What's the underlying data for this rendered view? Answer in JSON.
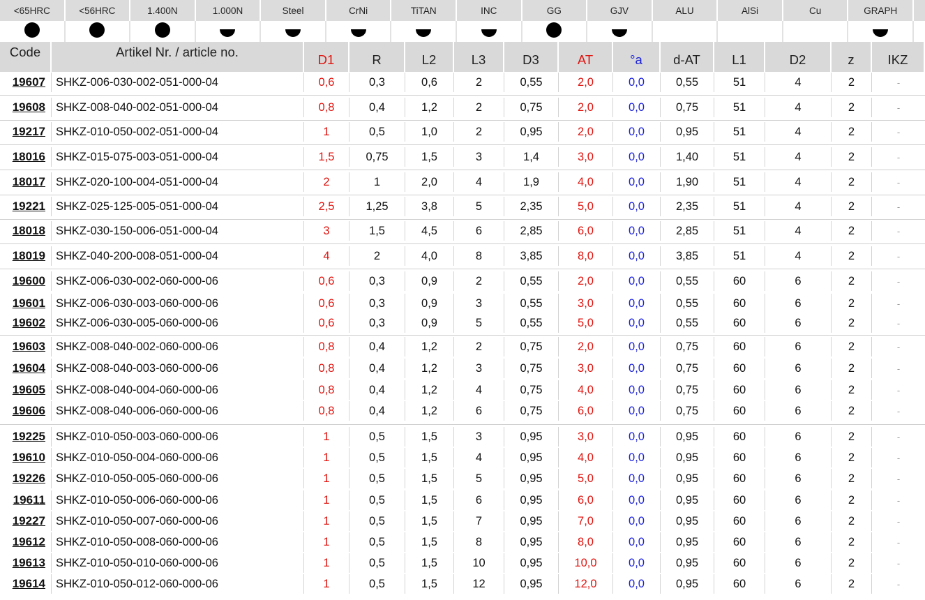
{
  "materials": {
    "labels": [
      "<65HRC",
      "<56HRC",
      "1.400N",
      "1.000N",
      "Steel",
      "CrNi",
      "TiTAN",
      "INC",
      "GG",
      "GJV",
      "ALU",
      "AlSi",
      "Cu",
      "GRAPH"
    ],
    "suitability": [
      "full",
      "full",
      "full",
      "half",
      "half",
      "half",
      "half",
      "half",
      "full",
      "half",
      "none",
      "none",
      "none",
      "half"
    ]
  },
  "columns": {
    "code": "Code",
    "article": "Artikel Nr. / article no.",
    "d1": "D1",
    "r": "R",
    "l2": "L2",
    "l3": "L3",
    "d3": "D3",
    "at": "AT",
    "angle": "°a",
    "dat": "d-AT",
    "l1": "L1",
    "d2": "D2",
    "z": "z",
    "ikz": "IKZ"
  },
  "rows": [
    {
      "code": "19607",
      "article": "SHKZ-006-030-002-051-000-04",
      "d1": "0,6",
      "r": "0,3",
      "l2": "0,6",
      "l3": "2",
      "d3": "0,55",
      "at": "2,0",
      "angle": "0,0",
      "dat": "0,55",
      "l1": "51",
      "d2": "4",
      "z": "2",
      "ikz": "-"
    },
    {
      "code": "19608",
      "article": "SHKZ-008-040-002-051-000-04",
      "d1": "0,8",
      "r": "0,4",
      "l2": "1,2",
      "l3": "2",
      "d3": "0,75",
      "at": "2,0",
      "angle": "0,0",
      "dat": "0,75",
      "l1": "51",
      "d2": "4",
      "z": "2",
      "ikz": "-"
    },
    {
      "code": "19217",
      "article": "SHKZ-010-050-002-051-000-04",
      "d1": "1",
      "r": "0,5",
      "l2": "1,0",
      "l3": "2",
      "d3": "0,95",
      "at": "2,0",
      "angle": "0,0",
      "dat": "0,95",
      "l1": "51",
      "d2": "4",
      "z": "2",
      "ikz": "-"
    },
    {
      "code": "18016",
      "article": "SHKZ-015-075-003-051-000-04",
      "d1": "1,5",
      "r": "0,75",
      "l2": "1,5",
      "l3": "3",
      "d3": "1,4",
      "at": "3,0",
      "angle": "0,0",
      "dat": "1,40",
      "l1": "51",
      "d2": "4",
      "z": "2",
      "ikz": "-"
    },
    {
      "code": "18017",
      "article": "SHKZ-020-100-004-051-000-04",
      "d1": "2",
      "r": "1",
      "l2": "2,0",
      "l3": "4",
      "d3": "1,9",
      "at": "4,0",
      "angle": "0,0",
      "dat": "1,90",
      "l1": "51",
      "d2": "4",
      "z": "2",
      "ikz": "-"
    },
    {
      "code": "19221",
      "article": "SHKZ-025-125-005-051-000-04",
      "d1": "2,5",
      "r": "1,25",
      "l2": "3,8",
      "l3": "5",
      "d3": "2,35",
      "at": "5,0",
      "angle": "0,0",
      "dat": "2,35",
      "l1": "51",
      "d2": "4",
      "z": "2",
      "ikz": "-"
    },
    {
      "code": "18018",
      "article": "SHKZ-030-150-006-051-000-04",
      "d1": "3",
      "r": "1,5",
      "l2": "4,5",
      "l3": "6",
      "d3": "2,85",
      "at": "6,0",
      "angle": "0,0",
      "dat": "2,85",
      "l1": "51",
      "d2": "4",
      "z": "2",
      "ikz": "-"
    },
    {
      "code": "18019",
      "article": "SHKZ-040-200-008-051-000-04",
      "d1": "4",
      "r": "2",
      "l2": "4,0",
      "l3": "8",
      "d3": "3,85",
      "at": "8,0",
      "angle": "0,0",
      "dat": "3,85",
      "l1": "51",
      "d2": "4",
      "z": "2",
      "ikz": "-"
    },
    {
      "code": "19600",
      "article": "SHKZ-006-030-002-060-000-06",
      "d1": "0,6",
      "r": "0,3",
      "l2": "0,9",
      "l3": "2",
      "d3": "0,55",
      "at": "2,0",
      "angle": "0,0",
      "dat": "0,55",
      "l1": "60",
      "d2": "6",
      "z": "2",
      "ikz": "-"
    },
    {
      "code": "19601",
      "article": "SHKZ-006-030-003-060-000-06",
      "d1": "0,6",
      "r": "0,3",
      "l2": "0,9",
      "l3": "3",
      "d3": "0,55",
      "at": "3,0",
      "angle": "0,0",
      "dat": "0,55",
      "l1": "60",
      "d2": "6",
      "z": "2",
      "ikz": "-"
    },
    {
      "code": "19602",
      "article": "SHKZ-006-030-005-060-000-06",
      "d1": "0,6",
      "r": "0,3",
      "l2": "0,9",
      "l3": "5",
      "d3": "0,55",
      "at": "5,0",
      "angle": "0,0",
      "dat": "0,55",
      "l1": "60",
      "d2": "6",
      "z": "2",
      "ikz": "-"
    },
    {
      "code": "19603",
      "article": "SHKZ-008-040-002-060-000-06",
      "d1": "0,8",
      "r": "0,4",
      "l2": "1,2",
      "l3": "2",
      "d3": "0,75",
      "at": "2,0",
      "angle": "0,0",
      "dat": "0,75",
      "l1": "60",
      "d2": "6",
      "z": "2",
      "ikz": "-"
    },
    {
      "code": "19604",
      "article": "SHKZ-008-040-003-060-000-06",
      "d1": "0,8",
      "r": "0,4",
      "l2": "1,2",
      "l3": "3",
      "d3": "0,75",
      "at": "3,0",
      "angle": "0,0",
      "dat": "0,75",
      "l1": "60",
      "d2": "6",
      "z": "2",
      "ikz": "-"
    },
    {
      "code": "19605",
      "article": "SHKZ-008-040-004-060-000-06",
      "d1": "0,8",
      "r": "0,4",
      "l2": "1,2",
      "l3": "4",
      "d3": "0,75",
      "at": "4,0",
      "angle": "0,0",
      "dat": "0,75",
      "l1": "60",
      "d2": "6",
      "z": "2",
      "ikz": "-"
    },
    {
      "code": "19606",
      "article": "SHKZ-008-040-006-060-000-06",
      "d1": "0,8",
      "r": "0,4",
      "l2": "1,2",
      "l3": "6",
      "d3": "0,75",
      "at": "6,0",
      "angle": "0,0",
      "dat": "0,75",
      "l1": "60",
      "d2": "6",
      "z": "2",
      "ikz": "-"
    },
    {
      "code": "19225",
      "article": "SHKZ-010-050-003-060-000-06",
      "d1": "1",
      "r": "0,5",
      "l2": "1,5",
      "l3": "3",
      "d3": "0,95",
      "at": "3,0",
      "angle": "0,0",
      "dat": "0,95",
      "l1": "60",
      "d2": "6",
      "z": "2",
      "ikz": "-"
    },
    {
      "code": "19610",
      "article": "SHKZ-010-050-004-060-000-06",
      "d1": "1",
      "r": "0,5",
      "l2": "1,5",
      "l3": "4",
      "d3": "0,95",
      "at": "4,0",
      "angle": "0,0",
      "dat": "0,95",
      "l1": "60",
      "d2": "6",
      "z": "2",
      "ikz": "-"
    },
    {
      "code": "19226",
      "article": "SHKZ-010-050-005-060-000-06",
      "d1": "1",
      "r": "0,5",
      "l2": "1,5",
      "l3": "5",
      "d3": "0,95",
      "at": "5,0",
      "angle": "0,0",
      "dat": "0,95",
      "l1": "60",
      "d2": "6",
      "z": "2",
      "ikz": "-"
    },
    {
      "code": "19611",
      "article": "SHKZ-010-050-006-060-000-06",
      "d1": "1",
      "r": "0,5",
      "l2": "1,5",
      "l3": "6",
      "d3": "0,95",
      "at": "6,0",
      "angle": "0,0",
      "dat": "0,95",
      "l1": "60",
      "d2": "6",
      "z": "2",
      "ikz": "-"
    },
    {
      "code": "19227",
      "article": "SHKZ-010-050-007-060-000-06",
      "d1": "1",
      "r": "0,5",
      "l2": "1,5",
      "l3": "7",
      "d3": "0,95",
      "at": "7,0",
      "angle": "0,0",
      "dat": "0,95",
      "l1": "60",
      "d2": "6",
      "z": "2",
      "ikz": "-"
    },
    {
      "code": "19612",
      "article": "SHKZ-010-050-008-060-000-06",
      "d1": "1",
      "r": "0,5",
      "l2": "1,5",
      "l3": "8",
      "d3": "0,95",
      "at": "8,0",
      "angle": "0,0",
      "dat": "0,95",
      "l1": "60",
      "d2": "6",
      "z": "2",
      "ikz": "-"
    },
    {
      "code": "19613",
      "article": "SHKZ-010-050-010-060-000-06",
      "d1": "1",
      "r": "0,5",
      "l2": "1,5",
      "l3": "10",
      "d3": "0,95",
      "at": "10,0",
      "angle": "0,0",
      "dat": "0,95",
      "l1": "60",
      "d2": "6",
      "z": "2",
      "ikz": "-"
    },
    {
      "code": "19614",
      "article": "SHKZ-010-050-012-060-000-06",
      "d1": "1",
      "r": "0,5",
      "l2": "1,5",
      "l3": "12",
      "d3": "0,95",
      "at": "12,0",
      "angle": "0,0",
      "dat": "0,95",
      "l1": "60",
      "d2": "6",
      "z": "2",
      "ikz": "-"
    }
  ],
  "colors": {
    "header_bg": "#d9d9d9",
    "red": "#e0140f",
    "blue": "#1d23d8"
  }
}
